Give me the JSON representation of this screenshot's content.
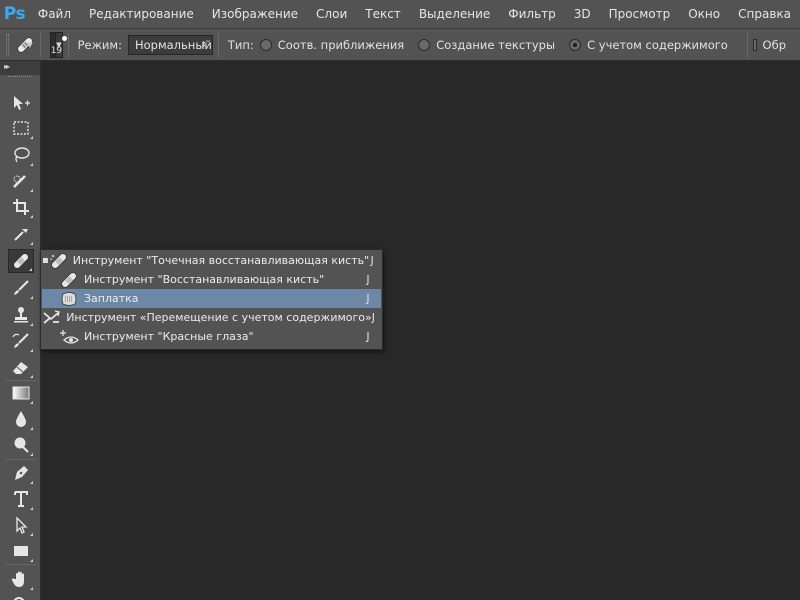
{
  "app": {
    "logo": "Ps"
  },
  "menu": [
    "Файл",
    "Редактирование",
    "Изображение",
    "Слои",
    "Текст",
    "Выделение",
    "Фильтр",
    "3D",
    "Просмотр",
    "Окно",
    "Справка"
  ],
  "options": {
    "brush_size": "19",
    "mode_label": "Режим:",
    "mode_value": "Нормальный",
    "type_label": "Тип:",
    "radio_1": "Соотв. приближения",
    "radio_2": "Создание текстуры",
    "radio_3": "С учетом содержимого",
    "selected_radio": 3,
    "checkbox_label": "Обр"
  },
  "flyout": {
    "items": [
      {
        "label": "Инструмент \"Точечная восстанавливающая кисть\"",
        "shortcut": "J",
        "icon": "spot-healing-brush-icon",
        "selected": true
      },
      {
        "label": "Инструмент \"Восстанавливающая кисть\"",
        "shortcut": "J",
        "icon": "healing-brush-icon"
      },
      {
        "label": "Заплатка",
        "shortcut": "J",
        "icon": "patch-icon",
        "highlighted": true
      },
      {
        "label": "Инструмент «Перемещение с учетом содержимого»",
        "shortcut": "J",
        "icon": "content-aware-move-icon"
      },
      {
        "label": "Инструмент \"Красные глаза\"",
        "shortcut": "J",
        "icon": "red-eye-icon"
      }
    ],
    "bullet": "▪"
  },
  "colors": {
    "ps_logo": "#3fa8f5",
    "panel": "#535353",
    "canvas": "#282828",
    "highlight": "#6d87a6"
  }
}
